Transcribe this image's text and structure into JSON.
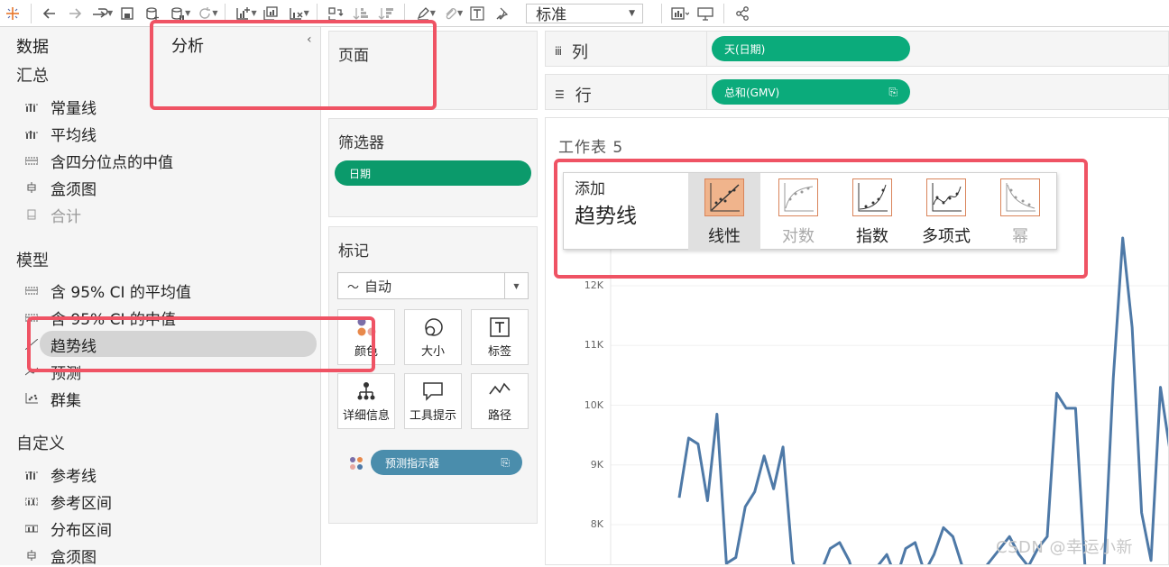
{
  "toolbar": {
    "fit_label": "标准"
  },
  "data_pane": {
    "tab_label": "数据"
  },
  "analytics_pane": {
    "tab_label": "分析",
    "sections": [
      {
        "title": "汇总",
        "items": [
          "常量线",
          "平均线",
          "含四分位点的中值",
          "盒须图",
          "合计"
        ]
      },
      {
        "title": "模型",
        "items": [
          "含 95% CI 的平均值",
          "含 95% CI 的中值",
          "趋势线",
          "预测",
          "群集"
        ]
      },
      {
        "title": "自定义",
        "items": [
          "参考线",
          "参考区间",
          "分布区间",
          "盒须图"
        ]
      }
    ],
    "selected_item": "趋势线",
    "disabled_item": "合计"
  },
  "pages_shelf": {
    "title": "页面"
  },
  "filters_shelf": {
    "title": "筛选器",
    "pill": "日期"
  },
  "marks_card": {
    "title": "标记",
    "mark_type": "自动",
    "buttons": [
      "颜色",
      "大小",
      "标签",
      "详细信息",
      "工具提示",
      "路径"
    ],
    "forecast_pill": "预测指示器"
  },
  "columns_shelf": {
    "label": "列",
    "pill": "天(日期)"
  },
  "rows_shelf": {
    "label": "行",
    "pill": "总和(GMV)"
  },
  "worksheet": {
    "title": "工作表 5"
  },
  "trend_popup": {
    "heading_small": "添加",
    "heading_large": "趋势线",
    "models": [
      {
        "label": "线性",
        "active": true,
        "enabled": true
      },
      {
        "label": "对数",
        "active": false,
        "enabled": false
      },
      {
        "label": "指数",
        "active": false,
        "enabled": true
      },
      {
        "label": "多项式",
        "active": false,
        "enabled": true
      },
      {
        "label": "幂",
        "active": false,
        "enabled": false
      }
    ]
  },
  "chart_data": {
    "type": "line",
    "title": "",
    "xlabel": "",
    "ylabel": "",
    "ylim": [
      7500,
      13500
    ],
    "y_ticks": [
      "8K",
      "9K",
      "10K",
      "11K",
      "12K"
    ],
    "y_tick_values": [
      8000,
      9000,
      10000,
      11000,
      12000
    ],
    "series": [
      {
        "color": "#4e79a7",
        "values": [
          8450,
          9450,
          9350,
          8400,
          9850,
          7350,
          7450,
          8300,
          8550,
          9150,
          8600,
          9300,
          7400,
          6900,
          7100,
          7200,
          7600,
          7700,
          7400,
          6900,
          7200,
          7300,
          7500,
          7100,
          7600,
          7700,
          7200,
          7500,
          7950,
          7800,
          7300,
          7000,
          7200,
          7400,
          7600,
          7800,
          7500,
          7300,
          7600,
          7800,
          10200,
          9950,
          9950,
          7300,
          6900,
          7200,
          10450,
          12800,
          11300,
          8200,
          7400,
          10300,
          9250
        ]
      }
    ]
  },
  "watermark": "CSDN @幸运小新"
}
